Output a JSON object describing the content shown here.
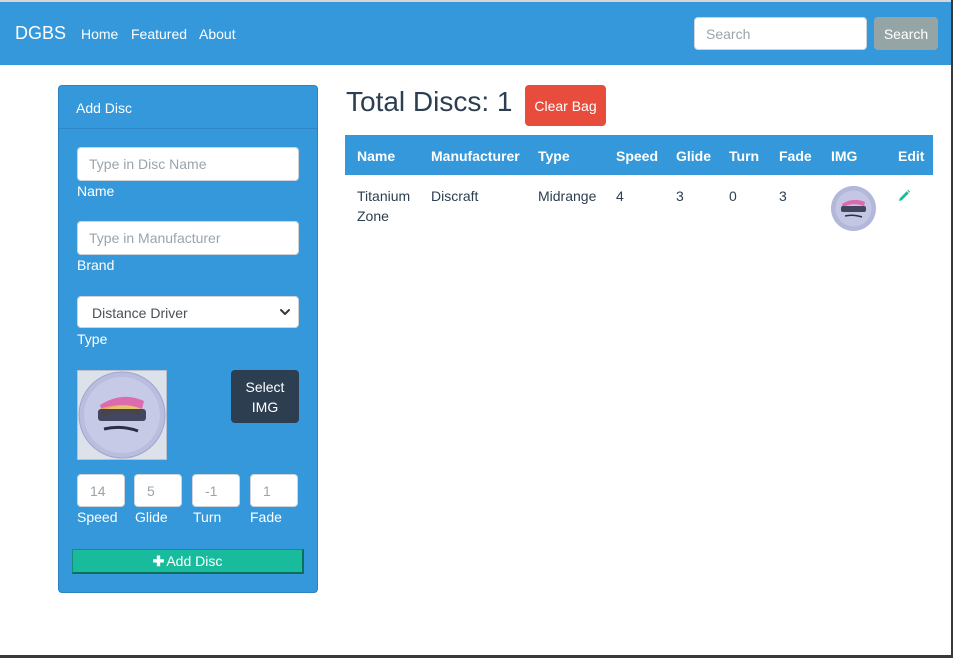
{
  "navbar": {
    "brand": "DGBS",
    "links": [
      "Home",
      "Featured",
      "About"
    ],
    "search": {
      "placeholder": "Search",
      "button_label": "Search"
    }
  },
  "add_disc_panel": {
    "title": "Add Disc",
    "name_field": {
      "placeholder": "Type in Disc Name",
      "label": "Name"
    },
    "manufacturer_field": {
      "placeholder": "Type in Manufacturer",
      "label": "Brand"
    },
    "type_field": {
      "selected": "Distance Driver",
      "label": "Type"
    },
    "select_img_label": "Select IMG",
    "preview_image": "titanium-zone-disc",
    "flight_numbers": [
      {
        "label": "Speed",
        "placeholder": "14"
      },
      {
        "label": "Glide",
        "placeholder": "5"
      },
      {
        "label": "Turn",
        "placeholder": "-1"
      },
      {
        "label": "Fade",
        "placeholder": "1"
      }
    ],
    "add_button_label": "Add Disc",
    "add_button_icon": "plus-icon"
  },
  "bag": {
    "total_label": "Total Discs: 1",
    "clear_button_label": "Clear Bag",
    "table": {
      "columns": [
        "Name",
        "Manufacturer",
        "Type",
        "Speed",
        "Glide",
        "Turn",
        "Fade",
        "IMG",
        "Edit"
      ],
      "rows": [
        {
          "name_line1": "Titanium",
          "name_line2": "Zone",
          "manufacturer": "Discraft",
          "type": "Midrange",
          "speed": "4",
          "glide": "3",
          "turn": "0",
          "fade": "3",
          "img": "titanium-zone-disc",
          "edit_icon": "pencil-icon"
        }
      ]
    }
  },
  "colors": {
    "primary": "#3498db",
    "danger": "#e74c3c",
    "success": "#18bc9c",
    "dark": "#2c3e50",
    "secondary": "#95a5a6"
  }
}
